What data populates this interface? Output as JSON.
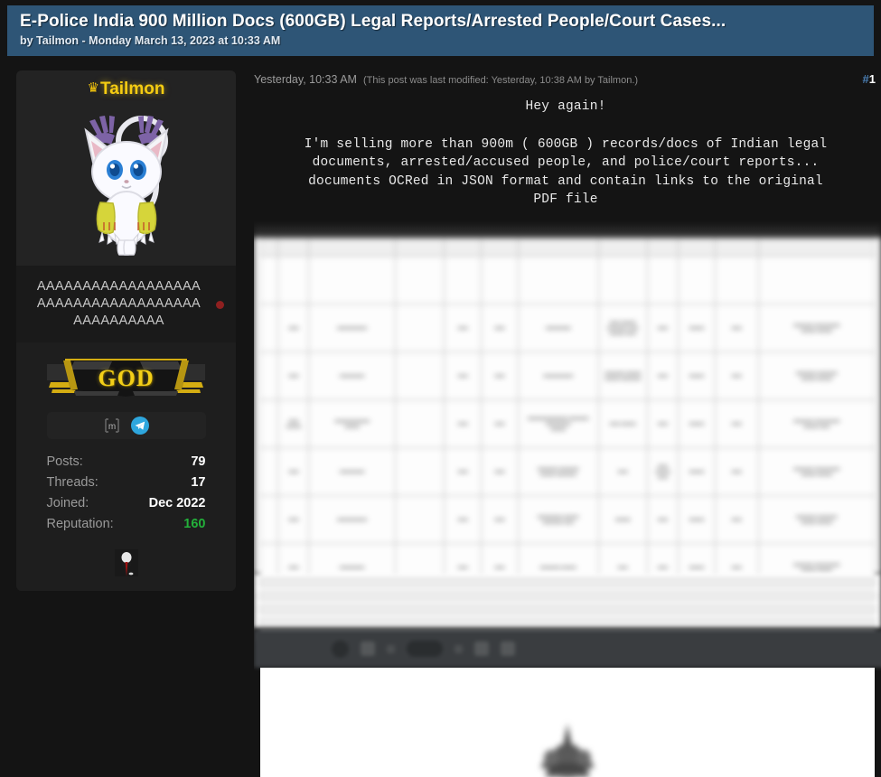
{
  "thread": {
    "title": "E-Police India 900 Million Docs (600GB) Legal Reports/Arrested People/Court Cases...",
    "byline": "by Tailmon - Monday March 13, 2023 at 10:33 AM",
    "header_color": "#2e5576"
  },
  "profile": {
    "crown_icon": "crown-icon",
    "username": "Tailmon",
    "username_color": "#f5cc12",
    "avatar_icon": "tailmon-cat-avatar",
    "user_title": "AAAAAAAAAAAAAAAAAAAAAAAAAAAAAAAAAAAAAAAAAAAAAA",
    "status": "offline",
    "status_color": "#8f2020",
    "rank": "GOD",
    "rank_color": "#f3cf18",
    "contacts": [
      {
        "name": "matrix-icon",
        "label": "Matrix"
      },
      {
        "name": "telegram-icon",
        "label": "Telegram",
        "color": "#2ea6dd"
      }
    ],
    "stats": [
      {
        "label": "Posts:",
        "value": "79"
      },
      {
        "label": "Threads:",
        "value": "17"
      },
      {
        "label": "Joined:",
        "value": "Dec 2022"
      },
      {
        "label": "Reputation:",
        "value": "160",
        "highlight": true
      }
    ],
    "reputation_color": "#23b03a",
    "badge_icon": "user-badge-icon"
  },
  "post": {
    "date": "Yesterday, 10:33 AM",
    "edited_note": "(This post was last modified: Yesterday, 10:38 AM by Tailmon.)",
    "number_hash": "#",
    "number": "1",
    "greeting": "Hey again!",
    "body_line_1": "I'm selling more than 900m ( 600GB ) records/docs of Indian legal",
    "body_line_2": "documents, arrested/accused people, and police/court reports...",
    "body_line_3": "documents OCRed in JSON format and contain links to the original",
    "body_line_4": "PDF file"
  },
  "attachment": {
    "name": "blurred-document-screenshot",
    "description": "Blurred spreadsheet of records above a PDF viewer toolbar and a white document page with an emblem",
    "toolbar_name": "pdf-viewer-toolbar",
    "page_name": "pdf-page-preview",
    "seal_name": "government-emblem-icon"
  }
}
